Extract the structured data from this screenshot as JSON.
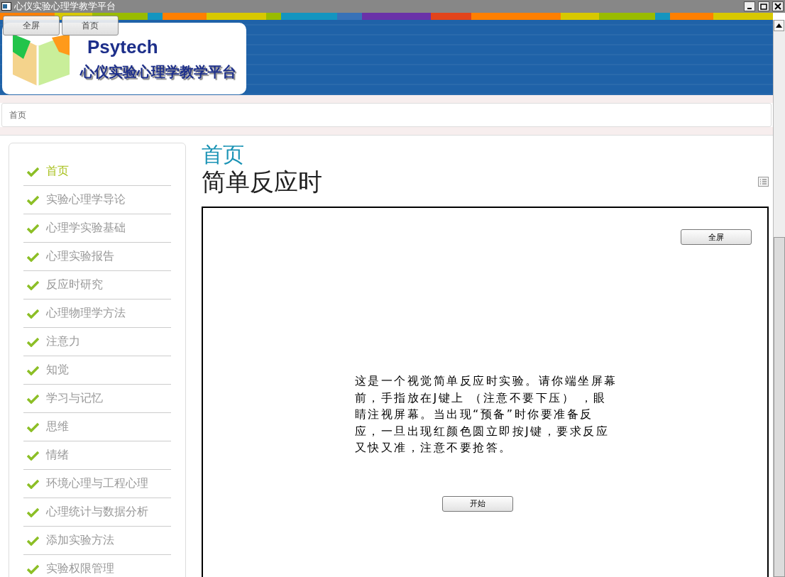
{
  "window": {
    "title": "心仪实验心理学教学平台"
  },
  "top_buttons": [
    "全屏",
    "首页"
  ],
  "logo": {
    "brand": "Psytech",
    "platform": "心仪实验心理学教学平台"
  },
  "breadcrumb": "首页",
  "sidebar": {
    "items": [
      {
        "label": "首页",
        "selected": true
      },
      {
        "label": "实验心理学导论",
        "selected": false
      },
      {
        "label": "心理学实验基础",
        "selected": false
      },
      {
        "label": "心理实验报告",
        "selected": false
      },
      {
        "label": "反应时研究",
        "selected": false
      },
      {
        "label": "心理物理学方法",
        "selected": false
      },
      {
        "label": "注意力",
        "selected": false
      },
      {
        "label": "知觉",
        "selected": false
      },
      {
        "label": "学习与记忆",
        "selected": false
      },
      {
        "label": "思维",
        "selected": false
      },
      {
        "label": "情绪",
        "selected": false
      },
      {
        "label": "环境心理与工程心理",
        "selected": false
      },
      {
        "label": "心理统计与数据分析",
        "selected": false
      },
      {
        "label": "添加实验方法",
        "selected": false
      },
      {
        "label": "实验权限管理",
        "selected": false
      }
    ]
  },
  "content": {
    "section": "首页",
    "title": "简单反应时",
    "experiment": {
      "fullscreen_button": "全屏",
      "instructions": "这是一个视觉简单反应时实验。请你端坐屏幕前，手指放在J键上 （注意不要下压） ，眼睛注视屏幕。当出现“预备”时你要准备反应，一旦出现红颜色圆立即按J键，要求反应又快又准，注意不要抢答。",
      "start_button": "开始"
    }
  }
}
